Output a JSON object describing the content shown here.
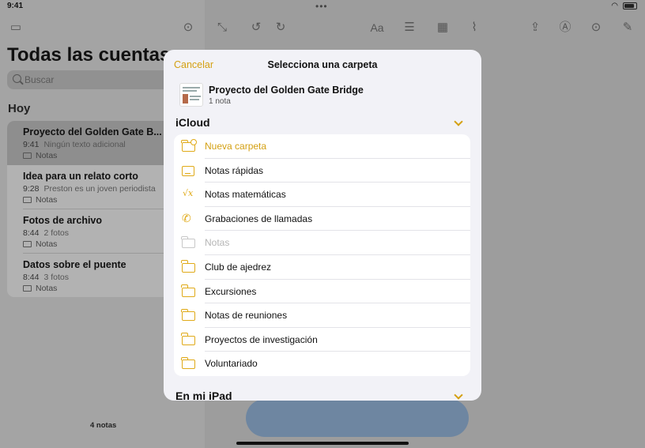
{
  "status_bar": {
    "time": "9:41",
    "dots": "•••"
  },
  "sidebar": {
    "title": "Todas las cuentas",
    "search_placeholder": "Buscar",
    "section": "Hoy",
    "notes": [
      {
        "title": "Proyecto del Golden Gate B...",
        "time": "9:41",
        "subtitle": "Ningún texto adicional",
        "folder": "Notas"
      },
      {
        "title": "Idea para un relato corto",
        "time": "9:28",
        "subtitle": "Preston es un joven periodista",
        "folder": "Notas"
      },
      {
        "title": "Fotos de archivo",
        "time": "8:44",
        "subtitle": "2 fotos",
        "folder": "Notas"
      },
      {
        "title": "Datos sobre el puente",
        "time": "8:44",
        "subtitle": "3 fotos",
        "folder": "Notas"
      }
    ],
    "notes_count": "4 notas"
  },
  "toolbar": {
    "format_label": "Aa"
  },
  "sheet": {
    "cancel_label": "Cancelar",
    "title": "Selecciona una carpeta",
    "note_name": "Proyecto del Golden Gate Bridge",
    "note_count": "1 nota",
    "groups": [
      {
        "label": "iCloud"
      },
      {
        "label": "En mi iPad"
      }
    ],
    "folders": [
      {
        "label": "Nueva carpeta",
        "icon": "new-folder-icon"
      },
      {
        "label": "Notas rápidas",
        "icon": "quick-notes-icon"
      },
      {
        "label": "Notas matemáticas",
        "icon": "math-notes-icon"
      },
      {
        "label": "Grabaciones de llamadas",
        "icon": "call-recordings-icon"
      },
      {
        "label": "Notas",
        "icon": "folder-icon"
      },
      {
        "label": "Club de ajedrez",
        "icon": "folder-icon"
      },
      {
        "label": "Excursiones",
        "icon": "folder-icon"
      },
      {
        "label": "Notas de reuniones",
        "icon": "folder-icon"
      },
      {
        "label": "Proyectos de investigación",
        "icon": "folder-icon"
      },
      {
        "label": "Voluntariado",
        "icon": "folder-icon"
      }
    ],
    "accent_color": "#d4a012"
  }
}
